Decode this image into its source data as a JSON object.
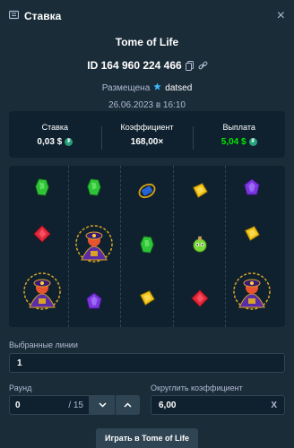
{
  "header": {
    "title": "Ставка",
    "close_icon": "close-icon"
  },
  "game": {
    "title": "Tome of Life"
  },
  "bet": {
    "id": "ID 164 960 224 466",
    "placed_label": "Размещена",
    "user": "datsed",
    "date": "26.06.2023 в 16:10"
  },
  "stats": {
    "bet_label": "Ставка",
    "bet_value": "0,03 $",
    "multiplier_label": "Коэффициент",
    "multiplier_value": "168,00×",
    "payout_label": "Выплата",
    "payout_value": "5,04 $"
  },
  "reels": [
    [
      "green-gem",
      "red-gem",
      "wizard"
    ],
    [
      "green-gem",
      "wizard",
      "purple-gem"
    ],
    [
      "blue-scroll",
      "green-gem",
      "yellow-gem"
    ],
    [
      "yellow-gem",
      "potion",
      "red-gem"
    ],
    [
      "purple-gem",
      "yellow-gem",
      "wizard"
    ]
  ],
  "form": {
    "lines_label": "Выбранные линии",
    "lines_value": "1",
    "round_label": "Раунд",
    "round_value": "0",
    "round_total": "/ 15",
    "round_multiplier_label": "Округлить коэффициент",
    "round_multiplier_value": "6,00",
    "clear_label": "X"
  },
  "play_button": "Играть в Tome of Life",
  "colors": {
    "background": "#1a2c38",
    "panel": "#0f212e",
    "border": "#2f4553",
    "muted": "#b1bad3",
    "payout_green": "#00e701",
    "tether": "#26a17b"
  }
}
